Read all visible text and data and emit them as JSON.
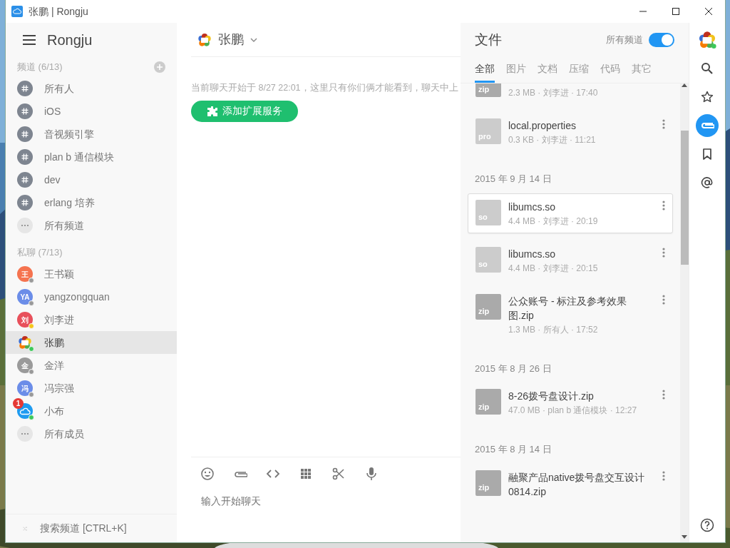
{
  "window": {
    "title": "张鹏 | Rongju"
  },
  "sidebar": {
    "title": "Rongju",
    "channels_header": "频道 (6/13)",
    "channels": [
      {
        "kind": "channel",
        "label": "所有人",
        "selected": false
      },
      {
        "kind": "channel",
        "label": "iOS",
        "selected": false
      },
      {
        "kind": "channel",
        "label": "音视频引擎",
        "selected": false
      },
      {
        "kind": "channel",
        "label": "plan b 通信模块",
        "selected": false
      },
      {
        "kind": "channel",
        "label": "dev",
        "selected": false
      },
      {
        "kind": "channel",
        "label": "erlang 培养",
        "selected": false
      },
      {
        "kind": "more",
        "label": "所有频道",
        "selected": false
      }
    ],
    "members_header": "私聊 (7/13)",
    "members": [
      {
        "kind": "user",
        "avatar": "王",
        "color": "#f5734f",
        "status_dot": {
          "color": "#999999"
        },
        "label": "王书颖",
        "selected": false
      },
      {
        "kind": "user",
        "avatar": "YA",
        "color": "#6b8de8",
        "status_dot": {
          "color": "#999999"
        },
        "label": "yangzongquan",
        "selected": false
      },
      {
        "kind": "user",
        "avatar": "刘",
        "color": "#e8505b",
        "status_dot": {
          "color": "#f5c518"
        },
        "label": "刘李进",
        "selected": false
      },
      {
        "kind": "logo",
        "status_dot": {
          "color": "#3cc85a"
        },
        "label": "张鹏",
        "selected": true
      },
      {
        "kind": "user",
        "avatar": "金",
        "color": "#9a9a9a",
        "status_dot": {
          "color": "#999999"
        },
        "label": "金洋",
        "selected": false
      },
      {
        "kind": "user",
        "avatar": "冯",
        "color": "#6b8de8",
        "status_dot": {
          "color": "#999999"
        },
        "label": "冯宗强",
        "selected": false
      },
      {
        "kind": "bot",
        "color": "#1e9bf0",
        "status_dot": {
          "color": "#3cc85a"
        },
        "badge": "1",
        "label": "小布",
        "selected": false
      },
      {
        "kind": "more",
        "label": "所有成员",
        "selected": false
      }
    ],
    "search_placeholder": "搜索频道 [CTRL+K]"
  },
  "chat": {
    "title": "张鹏",
    "notice": "当前聊天开始于 8/27 22:01，这里只有你们俩才能看到，聊天中上",
    "action_button": "添加扩展服务",
    "composer_placeholder": "输入开始聊天"
  },
  "files": {
    "title": "文件",
    "filter_label": "所有频道",
    "filter_on": true,
    "tabs": [
      {
        "label": "全部",
        "selected": true
      },
      {
        "label": "图片",
        "selected": false
      },
      {
        "label": "文档",
        "selected": false
      },
      {
        "label": "压缩",
        "selected": false
      },
      {
        "label": "代码",
        "selected": false
      },
      {
        "label": "其它",
        "selected": false
      }
    ],
    "entries": [
      {
        "kind": "file",
        "ext": "zip",
        "color": "#aaaaaa",
        "meta": "2.3 MB · 刘李进 · 17:40",
        "selected": false
      },
      {
        "kind": "file",
        "ext": "pro",
        "color": "#cccccc",
        "name": "local.properties",
        "meta": "0.3 KB · 刘李进 · 11:21",
        "selected": false
      },
      {
        "kind": "date",
        "label": "2015 年 9 月 14 日"
      },
      {
        "kind": "file",
        "ext": "so",
        "color": "#cccccc",
        "name": "libumcs.so",
        "meta": "4.4 MB · 刘李进 · 20:19",
        "selected": true
      },
      {
        "kind": "file",
        "ext": "so",
        "color": "#cccccc",
        "name": "libumcs.so",
        "meta": "4.4 MB · 刘李进 · 20:15",
        "selected": false
      },
      {
        "kind": "file",
        "ext": "zip",
        "color": "#aaaaaa",
        "name": "公众账号 - 标注及参考效果图.zip",
        "meta": "1.3 MB · 所有人 · 17:52",
        "selected": false
      },
      {
        "kind": "date",
        "label": "2015 年 8 月 26 日"
      },
      {
        "kind": "file",
        "ext": "zip",
        "color": "#aaaaaa",
        "name": "8-26拨号盘设计.zip",
        "meta": "47.0 MB · plan b 通信模块 · 12:27",
        "selected": false
      },
      {
        "kind": "date",
        "label": "2015 年 8 月 14 日"
      },
      {
        "kind": "file",
        "ext": "zip",
        "color": "#aaaaaa",
        "name": "融聚产品native拨号盘交互设计0814.zip",
        "selected": false
      }
    ]
  },
  "rail": [
    {
      "kind": "logo",
      "selected": false
    },
    {
      "kind": "search",
      "selected": false
    },
    {
      "kind": "star",
      "selected": false
    },
    {
      "kind": "clip",
      "selected": true
    },
    {
      "kind": "bookmark",
      "selected": false
    },
    {
      "kind": "at",
      "selected": false
    }
  ]
}
